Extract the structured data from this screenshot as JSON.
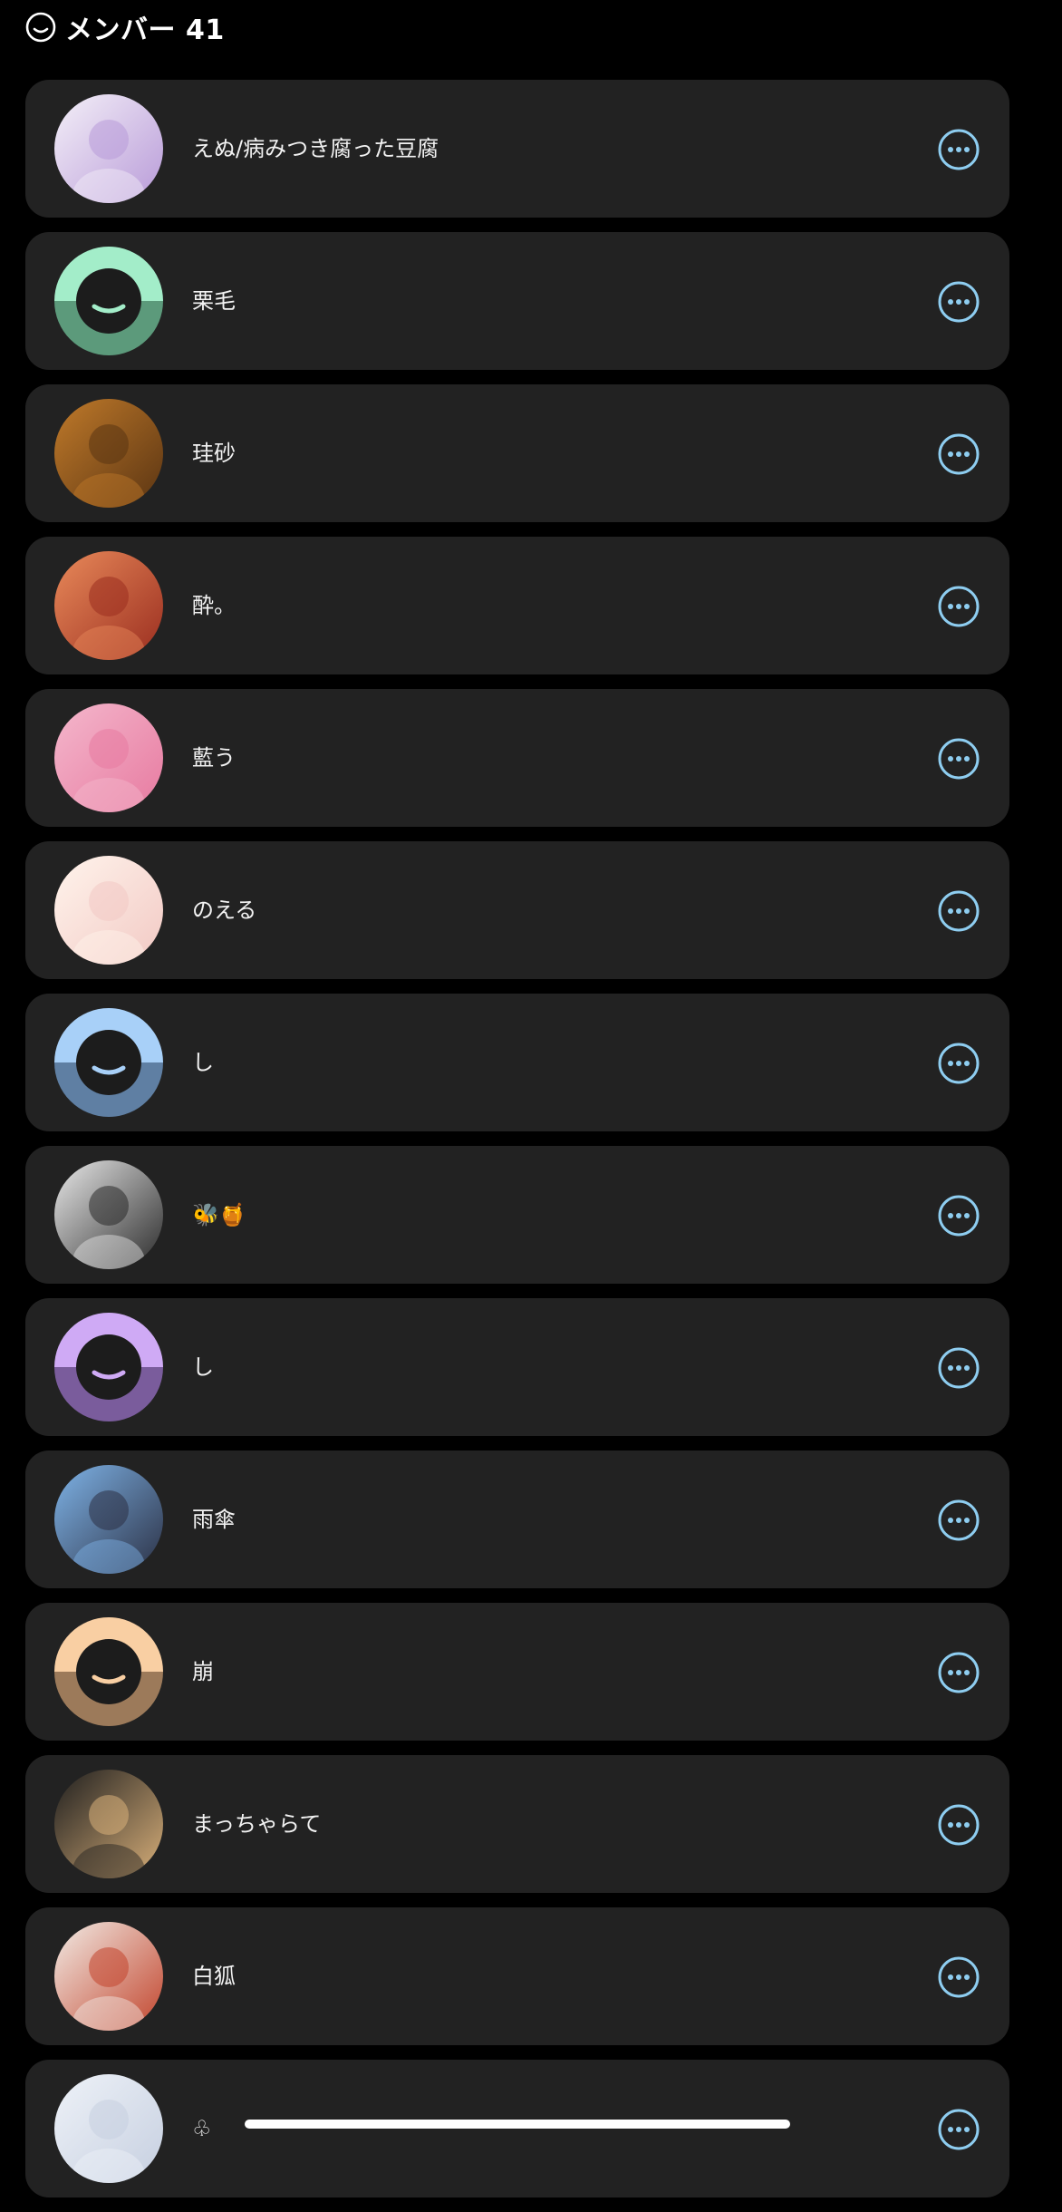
{
  "header": {
    "icon": "smiley-face-icon",
    "title": "メンバー 41"
  },
  "colors": {
    "accent": "#8ecdf0",
    "card": "#222222",
    "background": "#000000"
  },
  "members": [
    {
      "name": "えぬ/病みつき腐った豆腐",
      "avatar": "photo",
      "avatar_colors": [
        "#f4f0f8",
        "#b89ad8"
      ]
    },
    {
      "name": "栗毛",
      "avatar": "default",
      "avatar_colors": [
        "#a3edc9",
        "#5c9a7b"
      ]
    },
    {
      "name": "珪砂",
      "avatar": "photo",
      "avatar_colors": [
        "#c07a2a",
        "#5a3412"
      ]
    },
    {
      "name": "酔。",
      "avatar": "photo",
      "avatar_colors": [
        "#e98a5a",
        "#9a2d1f"
      ]
    },
    {
      "name": "藍う",
      "avatar": "photo",
      "avatar_colors": [
        "#f4b7cc",
        "#e77aa0"
      ]
    },
    {
      "name": "のえる",
      "avatar": "photo",
      "avatar_colors": [
        "#fff4ec",
        "#f2c9c4"
      ]
    },
    {
      "name": "し",
      "avatar": "default",
      "avatar_colors": [
        "#a8d0f8",
        "#5f7fa3"
      ]
    },
    {
      "name": "🐝🍯",
      "avatar": "photo",
      "avatar_colors": [
        "#e9e9e9",
        "#2a2a2a"
      ]
    },
    {
      "name": "し",
      "avatar": "default",
      "avatar_colors": [
        "#cfaaf5",
        "#7a5c9c"
      ]
    },
    {
      "name": "雨傘",
      "avatar": "photo",
      "avatar_colors": [
        "#7fb4e8",
        "#2b3044"
      ]
    },
    {
      "name": "崩",
      "avatar": "default",
      "avatar_colors": [
        "#f9cfa3",
        "#9c7a5a"
      ]
    },
    {
      "name": "まっちゃらて",
      "avatar": "photo",
      "avatar_colors": [
        "#1e1e1e",
        "#d9b07a"
      ]
    },
    {
      "name": "白狐",
      "avatar": "photo",
      "avatar_colors": [
        "#f2ece6",
        "#c2442c"
      ]
    },
    {
      "name": "♧",
      "avatar": "photo",
      "avatar_colors": [
        "#eef2f8",
        "#c6cfe0"
      ]
    }
  ],
  "row_action_icon": "more-options-icon"
}
